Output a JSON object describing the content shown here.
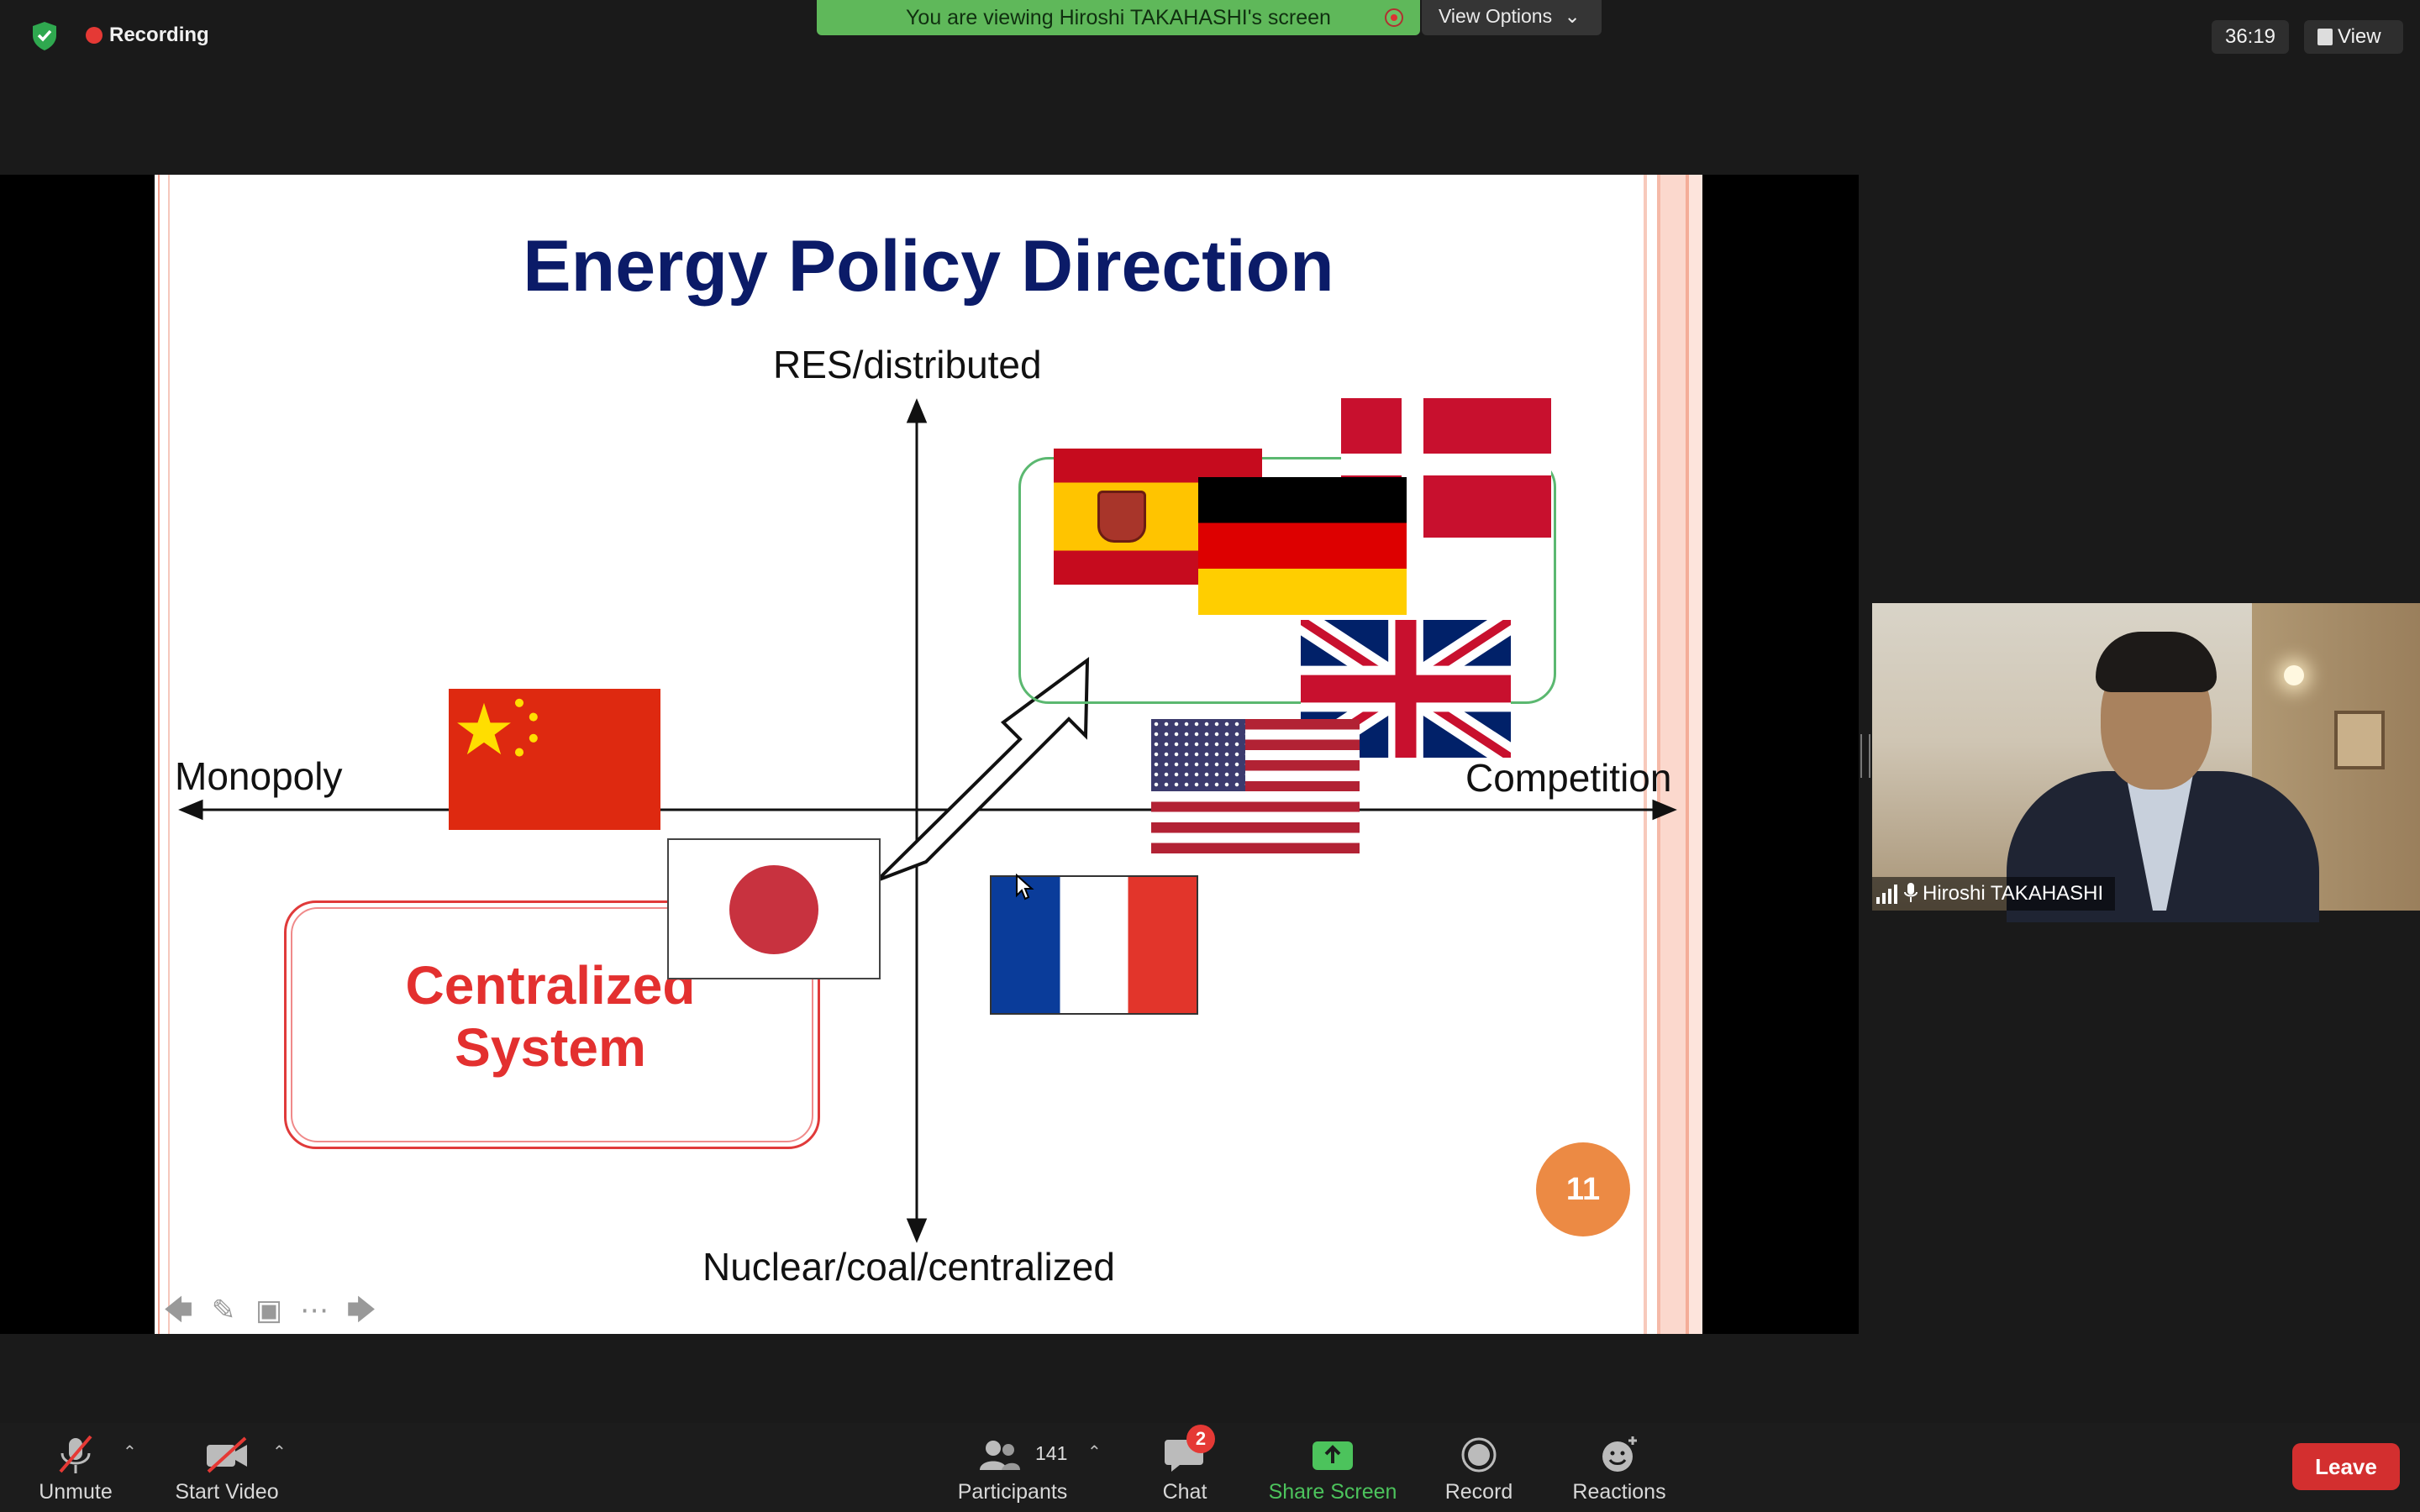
{
  "top_bar": {
    "recording_label": "Recording",
    "banner_text": "You are viewing Hiroshi TAKAHASHI's screen",
    "view_options_label": "View Options",
    "meeting_timer": "36:19",
    "view_label": "View"
  },
  "slide": {
    "title": "Energy Policy Direction",
    "axis_top": "RES/distributed",
    "axis_bottom": "Nuclear/coal/centralized",
    "axis_left": "Monopoly",
    "axis_right": "Competition",
    "centralized_line1": "Centralized",
    "centralized_line2": "System",
    "distributed_line1": "",
    "distributed_line2": "",
    "page_number": "11",
    "flags": [
      "china-flag",
      "spain-flag",
      "germany-flag",
      "denmark-flag",
      "uk-flag",
      "usa-flag",
      "france-flag",
      "japan-flag"
    ]
  },
  "video_tile": {
    "participant_name": "Hiroshi TAKAHASHI"
  },
  "toolbar": {
    "unmute_label": "Unmute",
    "start_video_label": "Start Video",
    "participants_label": "Participants",
    "participants_count": "141",
    "chat_label": "Chat",
    "chat_badge": "2",
    "share_screen_label": "Share Screen",
    "record_label": "Record",
    "reactions_label": "Reactions",
    "leave_label": "Leave"
  },
  "colors": {
    "share_banner": "#5fb85a",
    "leave_button": "#d32f2f",
    "recording_dot": "#e53935",
    "share_screen_green": "#4cc35c",
    "slide_title": "#0b1b68",
    "centralized_red": "#e3302f",
    "distributed_green": "#3cae56",
    "page_badge": "#ec8a44"
  }
}
